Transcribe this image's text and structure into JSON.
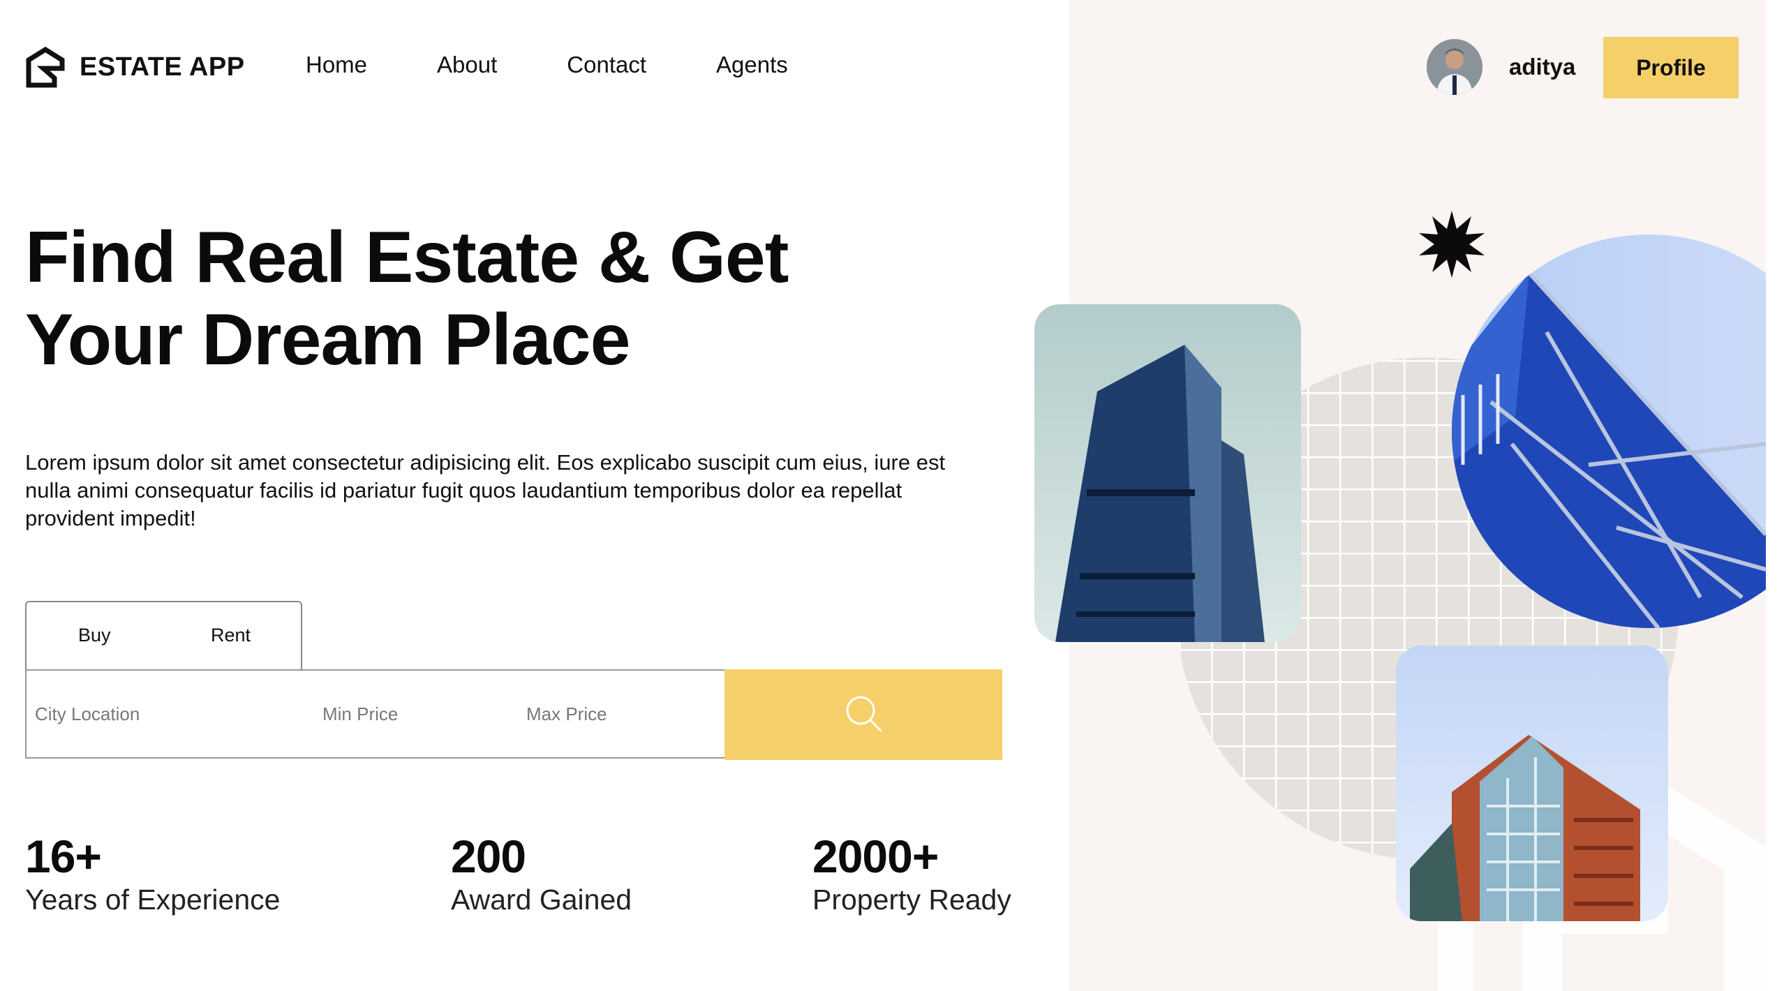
{
  "brand": {
    "name": "ESTATE APP",
    "logo_icon": "house-logo-icon"
  },
  "nav": {
    "items": [
      {
        "label": "Home"
      },
      {
        "label": "About"
      },
      {
        "label": "Contact"
      },
      {
        "label": "Agents"
      }
    ]
  },
  "user": {
    "name": "aditya",
    "avatar_icon": "user-avatar"
  },
  "profile_button": {
    "label": "Profile"
  },
  "hero": {
    "title": "Find Real Estate & Get Your Dream Place",
    "description": "Lorem ipsum dolor sit amet consectetur adipisicing elit. Eos explicabo suscipit cum eius, iure est nulla animi consequatur facilis id pariatur fugit quos laudantium temporibus dolor ea repellat provident impedit!"
  },
  "search": {
    "tabs": [
      {
        "label": "Buy"
      },
      {
        "label": "Rent"
      }
    ],
    "fields": {
      "city": {
        "placeholder": "City Location"
      },
      "min_price": {
        "placeholder": "Min Price"
      },
      "max_price": {
        "placeholder": "Max Price"
      }
    },
    "button_icon": "search-icon"
  },
  "stats": [
    {
      "value": "16+",
      "label": "Years of Experience"
    },
    {
      "value": "200",
      "label": "Award Gained"
    },
    {
      "value": "2000+",
      "label": "Property Ready"
    }
  ],
  "colors": {
    "accent": "#f5cf6a",
    "panel_background": "#faf5f3",
    "text": "#111111"
  }
}
